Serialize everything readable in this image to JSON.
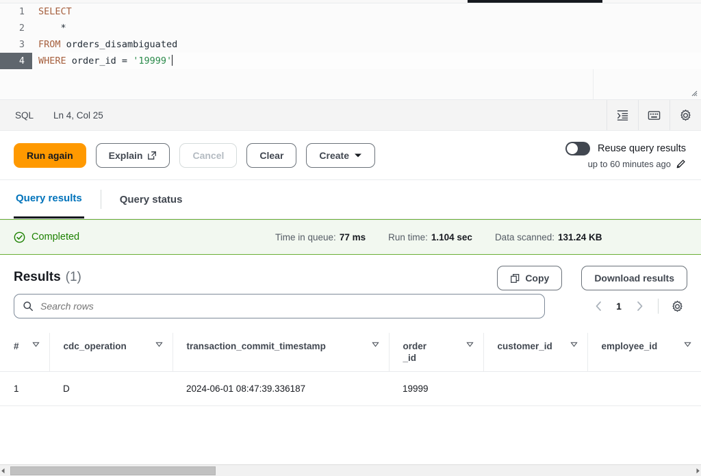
{
  "editor": {
    "lines": [
      {
        "num": "1",
        "tokens": [
          {
            "t": "SELECT",
            "c": "kw"
          }
        ]
      },
      {
        "num": "2",
        "tokens": [
          {
            "t": "    *",
            "c": "plain"
          }
        ]
      },
      {
        "num": "3",
        "tokens": [
          {
            "t": "FROM",
            "c": "kw"
          },
          {
            "t": " orders_disambiguated",
            "c": "plain"
          }
        ]
      },
      {
        "num": "4",
        "tokens": [
          {
            "t": "WHERE",
            "c": "kw"
          },
          {
            "t": " order_id = ",
            "c": "plain"
          },
          {
            "t": "'19999'",
            "c": "str"
          }
        ]
      }
    ],
    "line1": "SELECT",
    "line2": "    *",
    "line3_kw": "FROM",
    "line3_rest": " orders_disambiguated",
    "line4_kw": "WHERE",
    "line4_mid": " order_id = ",
    "line4_str": "'19999'",
    "num1": "1",
    "num2": "2",
    "num3": "3",
    "num4": "4",
    "active_line": 4,
    "resize_handle": "resize-grip-icon"
  },
  "sqlbar": {
    "language": "SQL",
    "cursor_position": "Ln 4, Col 25",
    "icons": [
      {
        "name": "format-indent-icon",
        "title": "Format query"
      },
      {
        "name": "keyboard-shortcuts-icon",
        "title": "Keyboard shortcuts"
      },
      {
        "name": "gear-icon",
        "title": "Settings"
      }
    ]
  },
  "actions": {
    "run_again": "Run again",
    "explain": "Explain",
    "explain_icon": "external-link-icon",
    "cancel": "Cancel",
    "cancel_disabled": true,
    "clear": "Clear",
    "create": "Create",
    "create_icon": "chevron-down-icon",
    "reuse_label": "Reuse query results",
    "reuse_sub": "up to 60 minutes ago",
    "reuse_edit_icon": "pencil-icon",
    "reuse_enabled": false
  },
  "tabs": {
    "query_results": "Query results",
    "query_status": "Query status",
    "selected": "Query results"
  },
  "status": {
    "state": "Completed",
    "state_icon": "check-circle-icon",
    "metrics": [
      {
        "key": "Time in queue:",
        "value": "77 ms"
      },
      {
        "key": "Run time:",
        "value": "1.104 sec"
      },
      {
        "key": "Data scanned:",
        "value": "131.24 KB"
      }
    ]
  },
  "results": {
    "title": "Results",
    "count": "(1)",
    "copy": "Copy",
    "copy_icon": "copy-icon",
    "download": "Download results",
    "search_placeholder": "Search rows",
    "search_value": "",
    "search_icon": "search-icon",
    "pager": {
      "prev_icon": "chevron-left-icon",
      "page": "1",
      "next_icon": "chevron-right-icon",
      "settings_icon": "gear-icon"
    },
    "columns": [
      {
        "label": "#",
        "sort_icon": "sort-icon"
      },
      {
        "label": "cdc_operation",
        "sort_icon": "sort-icon"
      },
      {
        "label": "transaction_commit_timestamp",
        "sort_icon": "sort-icon"
      },
      {
        "label": "order_id",
        "sort_icon": "sort-icon"
      },
      {
        "label": "customer_id",
        "sort_icon": "sort-icon"
      },
      {
        "label": "employee_id",
        "sort_icon": "sort-icon"
      }
    ],
    "rows": [
      {
        "num": "1",
        "cdc_operation": "D",
        "transaction_commit_timestamp": "2024-06-01 08:47:39.336187",
        "order_id": "19999",
        "customer_id": "",
        "employee_id": ""
      }
    ]
  },
  "colors": {
    "accent_orange": "#ff9900",
    "link_blue": "#0073bb",
    "success_green": "#1d8102",
    "banner_bg": "#f2f8f0"
  }
}
